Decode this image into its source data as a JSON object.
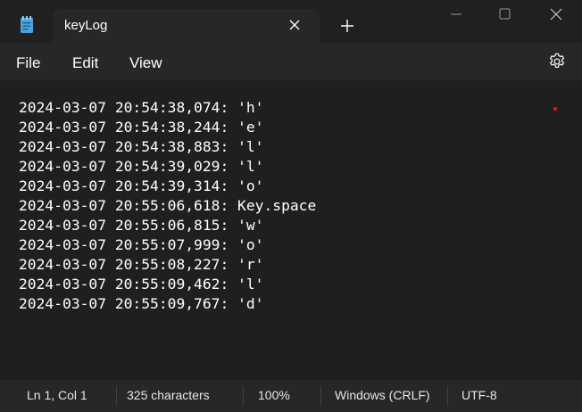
{
  "titlebar": {
    "tab_title": "keyLog",
    "new_tab_icon": "plus-icon",
    "app_icon": "notepad-icon",
    "minimize_icon": "minimize-icon",
    "maximize_icon": "maximize-icon",
    "close_icon": "close-icon"
  },
  "menu": {
    "items": [
      {
        "label": "File"
      },
      {
        "label": "Edit"
      },
      {
        "label": "View"
      }
    ],
    "settings_icon": "gear-icon"
  },
  "editor": {
    "lines": [
      "2024-03-07 20:54:38,074: 'h'",
      "2024-03-07 20:54:38,244: 'e'",
      "2024-03-07 20:54:38,883: 'l'",
      "2024-03-07 20:54:39,029: 'l'",
      "2024-03-07 20:54:39,314: 'o'",
      "2024-03-07 20:55:06,618: Key.space",
      "2024-03-07 20:55:06,815: 'w'",
      "2024-03-07 20:55:07,999: 'o'",
      "2024-03-07 20:55:08,227: 'r'",
      "2024-03-07 20:55:09,462: 'l'",
      "2024-03-07 20:55:09,767: 'd'"
    ]
  },
  "status": {
    "position": "Ln 1, Col 1",
    "characters": "325 characters",
    "zoom": "100%",
    "line_ending": "Windows (CRLF)",
    "encoding": "UTF-8"
  },
  "colors": {
    "titlebar_bg": "#202020",
    "chrome_bg": "#272727",
    "editor_bg": "#1f1f1f",
    "text": "#ffffff",
    "icon_blue": "#4aa3df"
  }
}
